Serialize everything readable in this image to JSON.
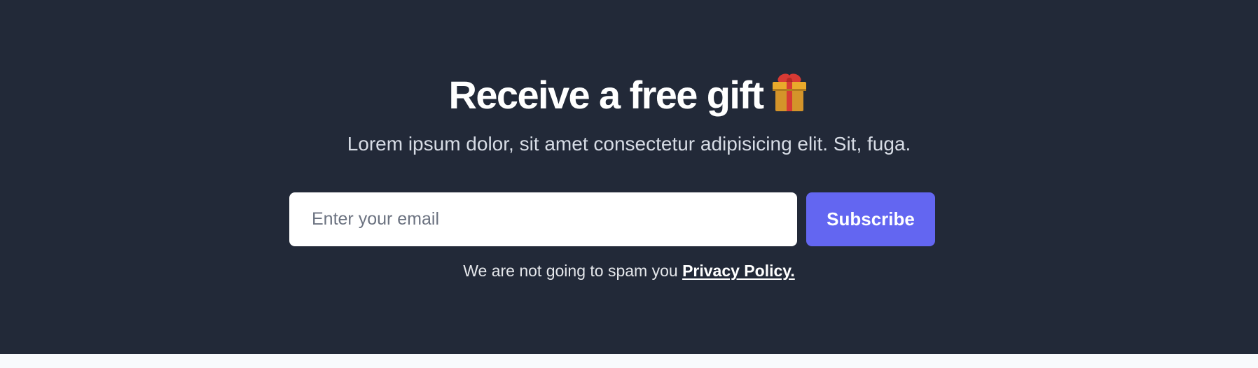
{
  "newsletter": {
    "title": "Receive a free gift",
    "gift_emoji": "🎁",
    "subtitle": "Lorem ipsum dolor, sit amet consectetur adipisicing elit. Sit, fuga.",
    "email_placeholder": "Enter your email",
    "email_value": "",
    "subscribe_label": "Subscribe",
    "disclaimer_text": "We are not going to spam you",
    "privacy_link_label": "Privacy Policy."
  },
  "colors": {
    "background": "#222938",
    "accent": "#6366f1",
    "footer_strip": "#f8fafc"
  }
}
